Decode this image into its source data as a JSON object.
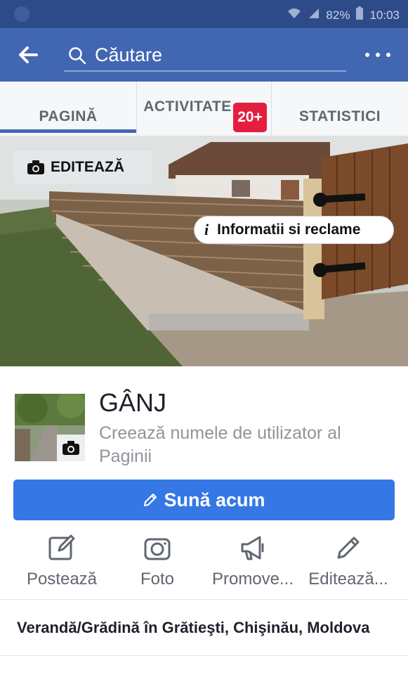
{
  "status_bar": {
    "battery": "82%",
    "time": "10:03"
  },
  "search": {
    "placeholder": "Căutare"
  },
  "tabs": [
    {
      "label": "PAGINĂ"
    },
    {
      "label": "ACTIVITATE"
    },
    {
      "label": "STATISTICI"
    }
  ],
  "activity_badge": "20+",
  "cover": {
    "edit_label": "EDITEAZĂ",
    "info_label": "Informatii si reclame"
  },
  "page": {
    "title": "GÂNJ",
    "username_prompt": "Creează numele de utilizator al Paginii"
  },
  "call_button": {
    "label": "Sună acum"
  },
  "actions": [
    {
      "icon": "compose-icon",
      "label": "Postează"
    },
    {
      "icon": "camera-icon",
      "label": "Foto"
    },
    {
      "icon": "megaphone-icon",
      "label": "Promove..."
    },
    {
      "icon": "pencil-icon",
      "label": "Editează..."
    }
  ],
  "category": "Verandă/Grădină în Grătieşti, Chişinău, Moldova",
  "colors": {
    "brand": "#4267b2",
    "status_bar": "#2d4b89",
    "call_button": "#3578e5",
    "badge": "#e41e3f"
  }
}
